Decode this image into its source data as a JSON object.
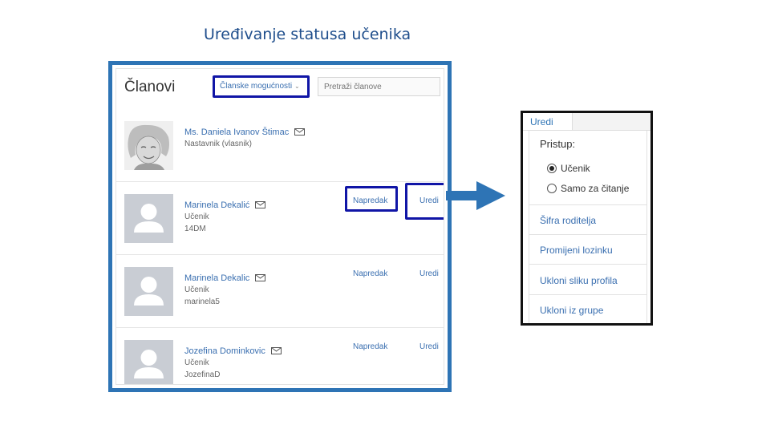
{
  "slide": {
    "title": "Uređivanje statusa učenika"
  },
  "members": {
    "title": "Članovi",
    "options_label": "Članske mogućnosti",
    "search_placeholder": "Pretraži članove",
    "rows": [
      {
        "name": "Ms. Daniela Ivanov Štimac",
        "role": "Nastavnik (vlasnik)",
        "username": "",
        "progress": "",
        "edit": "",
        "avatar": "photo"
      },
      {
        "name": "Marinela Dekalić",
        "role": "Učenik",
        "username": "14DM",
        "progress": "Napredak",
        "edit": "Uredi",
        "avatar": "placeholder"
      },
      {
        "name": "Marinela Dekalic",
        "role": "Učenik",
        "username": "marinela5",
        "progress": "Napredak",
        "edit": "Uredi",
        "avatar": "placeholder"
      },
      {
        "name": "Jozefina Dominkovic",
        "role": "Učenik",
        "username": "JozefinaD",
        "progress": "Napredak",
        "edit": "Uredi",
        "avatar": "placeholder"
      }
    ]
  },
  "edit_menu": {
    "tab": "Uredi",
    "access_label": "Pristup:",
    "options": [
      {
        "label": "Učenik",
        "selected": true
      },
      {
        "label": "Samo za čitanje",
        "selected": false
      }
    ],
    "links": [
      "Šifra roditelja",
      "Promijeni lozinku",
      "Ukloni sliku profila",
      "Ukloni iz grupe"
    ]
  },
  "colors": {
    "frame": "#2e74b5",
    "highlight": "#1015a6",
    "link": "#3a6fb0"
  },
  "icons": {
    "mail": "envelope-icon",
    "arrow": "arrow-right-icon",
    "avatar": "user-silhouette-icon"
  }
}
